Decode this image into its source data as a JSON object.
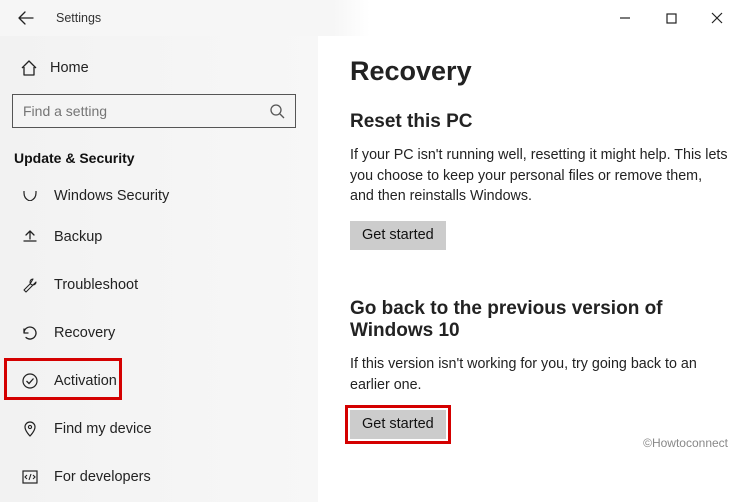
{
  "window": {
    "title": "Settings"
  },
  "sidebar": {
    "home_label": "Home",
    "search_placeholder": "Find a setting",
    "section_label": "Update & Security",
    "items": [
      {
        "label": "Windows Security"
      },
      {
        "label": "Backup"
      },
      {
        "label": "Troubleshoot"
      },
      {
        "label": "Recovery"
      },
      {
        "label": "Activation"
      },
      {
        "label": "Find my device"
      },
      {
        "label": "For developers"
      }
    ]
  },
  "main": {
    "page_title": "Recovery",
    "reset": {
      "heading": "Reset this PC",
      "body": "If your PC isn't running well, resetting it might help. This lets you choose to keep your personal files or remove them, and then reinstalls Windows.",
      "button": "Get started"
    },
    "goback": {
      "heading": "Go back to the previous version of Windows 10",
      "body": "If this version isn't working for you, try going back to an earlier one.",
      "button": "Get started"
    }
  },
  "watermark": "©Howtoconnect"
}
